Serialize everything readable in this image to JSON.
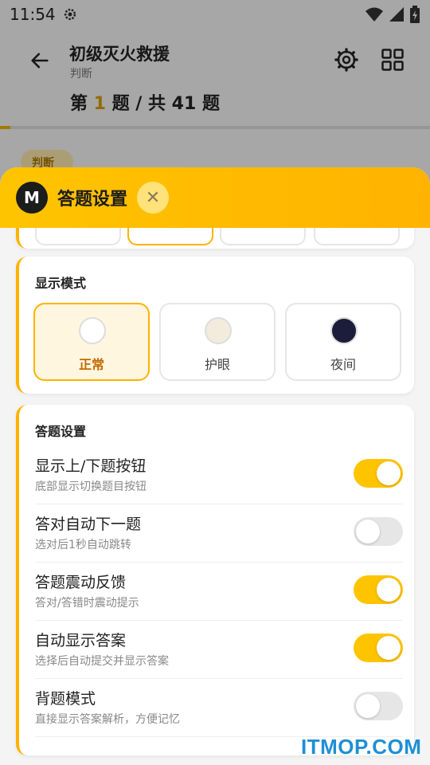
{
  "status_bar": {
    "time": "11:54"
  },
  "header": {
    "title": "初级灭火救援",
    "subtitle": "判断",
    "progress_prefix": "第 ",
    "progress_current": "1",
    "progress_middle": " 题 / 共 ",
    "progress_total": "41",
    "progress_suffix": " 题",
    "progress_fraction": 0.024,
    "question_type_chip": "判断"
  },
  "sheet": {
    "avatar_letter": "M",
    "title": "答题设置",
    "close_glyph": "✕",
    "display_mode": {
      "title": "显示模式",
      "options": [
        {
          "label": "正常",
          "dot_color": "#ffffff",
          "selected": true
        },
        {
          "label": "护眼",
          "dot_color": "#f3ecdc",
          "selected": false
        },
        {
          "label": "夜间",
          "dot_color": "#1b1d3a",
          "selected": false
        }
      ]
    },
    "answer_settings": {
      "title": "答题设置",
      "items": [
        {
          "title": "显示上/下题按钮",
          "desc": "底部显示切换题目按钮",
          "on": true
        },
        {
          "title": "答对自动下一题",
          "desc": "选对后1秒自动跳转",
          "on": false
        },
        {
          "title": "答题震动反馈",
          "desc": "答对/答错时震动提示",
          "on": true
        },
        {
          "title": "自动显示答案",
          "desc": "选择后自动提交并显示答案",
          "on": true
        },
        {
          "title": "背题模式",
          "desc": "直接显示答案解析，方便记忆",
          "on": false
        }
      ]
    }
  },
  "colors": {
    "accent": "#ffc400",
    "accent_dark": "#ffb300",
    "active_text": "#c26a00"
  },
  "watermark": "ITMOP.COM"
}
